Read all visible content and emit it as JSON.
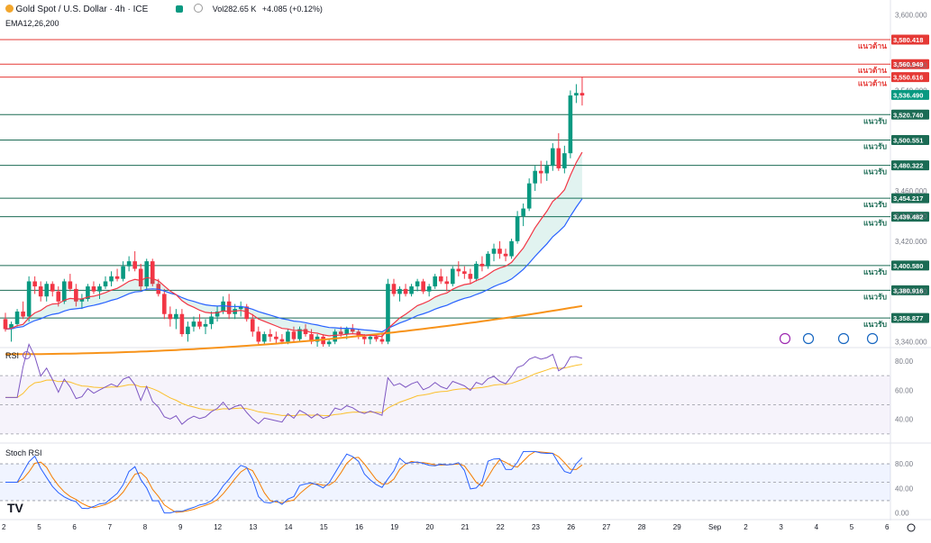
{
  "header": {
    "symbol": "Gold Spot / U.S. Dollar · 4h · ICE",
    "volume_label": "Vol",
    "volume_value": "282.65 K",
    "change": "+4.085 (+0.12%)",
    "indicator": "EMA12,26,200"
  },
  "colors": {
    "up": "#089981",
    "down": "#f23645",
    "ema12": "#f23645",
    "ema26": "#2962ff",
    "ema200": "#f7931a",
    "resistance": "#e53935",
    "support": "#1b6b54",
    "rsi": "#7e57c2",
    "rsi_ma": "#fbc02d",
    "stoch_k": "#2962ff",
    "stoch_d": "#f57c00"
  },
  "price_axis": {
    "ticks": [
      "3,600.000",
      "3,560.000",
      "3,540.000",
      "3,460.000",
      "3,440.000",
      "3,420.000",
      "3,380.000",
      "3,340.000"
    ],
    "current_price": "3,536.490"
  },
  "levels": [
    {
      "label": "3,580.418",
      "kind": "resistance",
      "text": "แนวต้าน"
    },
    {
      "label": "3,560.949",
      "kind": "resistance",
      "text": "แนวต้าน"
    },
    {
      "label": "3,550.616",
      "kind": "resistance",
      "text": "แนวต้าน"
    },
    {
      "label": "3,520.740",
      "kind": "support",
      "text": "แนวรับ"
    },
    {
      "label": "3,500.551",
      "kind": "support",
      "text": "แนวรับ"
    },
    {
      "label": "3,480.322",
      "kind": "support",
      "text": "แนวรับ"
    },
    {
      "label": "3,454.217",
      "kind": "support",
      "text": "แนวรับ"
    },
    {
      "label": "3,439.482",
      "kind": "support",
      "text": "แนวรับ"
    },
    {
      "label": "3,400.580",
      "kind": "support",
      "text": "แนวรับ"
    },
    {
      "label": "3,380.916",
      "kind": "support",
      "text": "แนวรับ"
    },
    {
      "label": "3,358.877",
      "kind": "support",
      "text": "แนวรับ"
    }
  ],
  "rsi_panel": {
    "title": "RSI",
    "ticks": [
      "80.00",
      "60.00",
      "40.00"
    ]
  },
  "stoch_panel": {
    "title": "Stoch RSI",
    "ticks": [
      "80.00",
      "40.00",
      "0.00"
    ]
  },
  "time_axis": [
    "2",
    "5",
    "6",
    "7",
    "8",
    "9",
    "12",
    "13",
    "14",
    "15",
    "16",
    "19",
    "20",
    "21",
    "22",
    "23",
    "26",
    "27",
    "28",
    "29",
    "Sep",
    "2",
    "3",
    "4",
    "5",
    "6"
  ],
  "chart_data": {
    "type": "candlestick",
    "timeframe": "4h",
    "y_range": [
      3336,
      3612
    ],
    "candles": [
      [
        3358,
        3363,
        3348,
        3350
      ],
      [
        3350,
        3356,
        3340,
        3354
      ],
      [
        3354,
        3366,
        3352,
        3364
      ],
      [
        3364,
        3372,
        3358,
        3360
      ],
      [
        3360,
        3392,
        3356,
        3388
      ],
      [
        3388,
        3392,
        3378,
        3384
      ],
      [
        3384,
        3388,
        3372,
        3376
      ],
      [
        3376,
        3388,
        3372,
        3386
      ],
      [
        3386,
        3388,
        3376,
        3380
      ],
      [
        3380,
        3384,
        3368,
        3372
      ],
      [
        3372,
        3390,
        3370,
        3388
      ],
      [
        3388,
        3394,
        3380,
        3382
      ],
      [
        3382,
        3386,
        3368,
        3372
      ],
      [
        3372,
        3378,
        3366,
        3374
      ],
      [
        3374,
        3386,
        3372,
        3384
      ],
      [
        3384,
        3388,
        3378,
        3380
      ],
      [
        3380,
        3386,
        3374,
        3384
      ],
      [
        3384,
        3392,
        3382,
        3388
      ],
      [
        3388,
        3396,
        3384,
        3392
      ],
      [
        3392,
        3398,
        3388,
        3390
      ],
      [
        3390,
        3404,
        3388,
        3400
      ],
      [
        3400,
        3408,
        3396,
        3404
      ],
      [
        3404,
        3412,
        3396,
        3398
      ],
      [
        3398,
        3402,
        3380,
        3384
      ],
      [
        3384,
        3406,
        3382,
        3404
      ],
      [
        3404,
        3406,
        3384,
        3386
      ],
      [
        3386,
        3390,
        3376,
        3378
      ],
      [
        3378,
        3382,
        3358,
        3362
      ],
      [
        3362,
        3368,
        3352,
        3358
      ],
      [
        3358,
        3366,
        3350,
        3362
      ],
      [
        3362,
        3366,
        3344,
        3346
      ],
      [
        3346,
        3356,
        3340,
        3352
      ],
      [
        3352,
        3360,
        3348,
        3356
      ],
      [
        3356,
        3362,
        3350,
        3352
      ],
      [
        3352,
        3358,
        3346,
        3354
      ],
      [
        3354,
        3364,
        3350,
        3360
      ],
      [
        3360,
        3368,
        3356,
        3364
      ],
      [
        3364,
        3376,
        3362,
        3372
      ],
      [
        3372,
        3378,
        3358,
        3362
      ],
      [
        3362,
        3370,
        3358,
        3366
      ],
      [
        3366,
        3372,
        3360,
        3368
      ],
      [
        3368,
        3370,
        3356,
        3358
      ],
      [
        3358,
        3362,
        3344,
        3348
      ],
      [
        3348,
        3352,
        3338,
        3340
      ],
      [
        3340,
        3348,
        3338,
        3346
      ],
      [
        3346,
        3350,
        3340,
        3344
      ],
      [
        3344,
        3348,
        3338,
        3342
      ],
      [
        3342,
        3346,
        3338,
        3340
      ],
      [
        3340,
        3350,
        3338,
        3348
      ],
      [
        3348,
        3352,
        3340,
        3342
      ],
      [
        3342,
        3352,
        3340,
        3350
      ],
      [
        3350,
        3354,
        3344,
        3346
      ],
      [
        3346,
        3350,
        3338,
        3340
      ],
      [
        3340,
        3346,
        3336,
        3344
      ],
      [
        3344,
        3346,
        3336,
        3338
      ],
      [
        3338,
        3342,
        3336,
        3340
      ],
      [
        3340,
        3350,
        3338,
        3348
      ],
      [
        3348,
        3352,
        3344,
        3346
      ],
      [
        3346,
        3352,
        3342,
        3350
      ],
      [
        3350,
        3354,
        3346,
        3348
      ],
      [
        3348,
        3350,
        3342,
        3344
      ],
      [
        3344,
        3346,
        3338,
        3342
      ],
      [
        3342,
        3346,
        3338,
        3344
      ],
      [
        3344,
        3346,
        3340,
        3342
      ],
      [
        3342,
        3346,
        3338,
        3340
      ],
      [
        3340,
        3390,
        3338,
        3386
      ],
      [
        3386,
        3390,
        3376,
        3378
      ],
      [
        3378,
        3384,
        3372,
        3382
      ],
      [
        3382,
        3386,
        3376,
        3378
      ],
      [
        3378,
        3386,
        3376,
        3384
      ],
      [
        3384,
        3390,
        3380,
        3388
      ],
      [
        3388,
        3390,
        3378,
        3380
      ],
      [
        3380,
        3386,
        3376,
        3384
      ],
      [
        3384,
        3394,
        3382,
        3392
      ],
      [
        3392,
        3398,
        3386,
        3388
      ],
      [
        3388,
        3392,
        3380,
        3386
      ],
      [
        3386,
        3400,
        3384,
        3398
      ],
      [
        3398,
        3404,
        3392,
        3396
      ],
      [
        3396,
        3400,
        3390,
        3394
      ],
      [
        3394,
        3398,
        3386,
        3390
      ],
      [
        3390,
        3404,
        3388,
        3402
      ],
      [
        3402,
        3408,
        3396,
        3400
      ],
      [
        3400,
        3412,
        3398,
        3410
      ],
      [
        3410,
        3418,
        3404,
        3414
      ],
      [
        3414,
        3420,
        3406,
        3410
      ],
      [
        3410,
        3414,
        3404,
        3408
      ],
      [
        3408,
        3422,
        3406,
        3420
      ],
      [
        3420,
        3444,
        3418,
        3440
      ],
      [
        3440,
        3450,
        3432,
        3446
      ],
      [
        3446,
        3470,
        3444,
        3466
      ],
      [
        3466,
        3480,
        3460,
        3476
      ],
      [
        3476,
        3484,
        3466,
        3474
      ],
      [
        3474,
        3484,
        3468,
        3480
      ],
      [
        3480,
        3498,
        3476,
        3494
      ],
      [
        3494,
        3506,
        3476,
        3478
      ],
      [
        3478,
        3496,
        3474,
        3490
      ],
      [
        3490,
        3540,
        3486,
        3536
      ],
      [
        3536,
        3545,
        3530,
        3538
      ],
      [
        3538,
        3551,
        3528,
        3536
      ]
    ]
  }
}
